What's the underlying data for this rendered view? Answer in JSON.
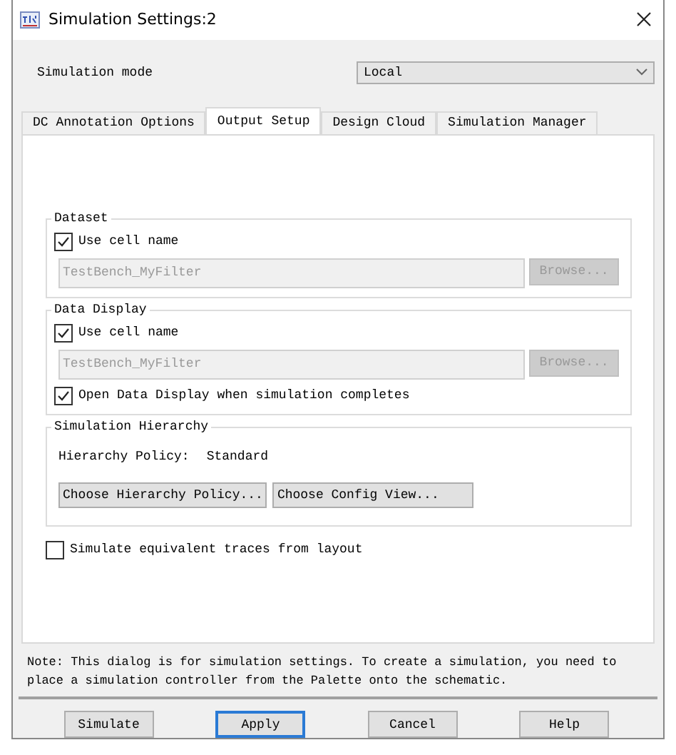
{
  "window": {
    "title": "Simulation Settings:2"
  },
  "simulation_mode": {
    "label": "Simulation mode",
    "value": "Local"
  },
  "tabs": [
    {
      "label": "DC Annotation Options",
      "selected": false
    },
    {
      "label": "Output Setup",
      "selected": true
    },
    {
      "label": "Design Cloud",
      "selected": false
    },
    {
      "label": "Simulation Manager",
      "selected": false
    }
  ],
  "groups": [
    {
      "title": "Dataset",
      "rows": [
        {
          "kind": "checkbox",
          "label": "Use cell name",
          "checked": true
        },
        {
          "kind": "path",
          "value": "TestBench_MyFilter",
          "button": "Browse...",
          "disabled": true
        }
      ]
    },
    {
      "title": "Data Display",
      "rows": [
        {
          "kind": "checkbox",
          "label": "Use cell name",
          "checked": true
        },
        {
          "kind": "path",
          "value": "TestBench_MyFilter",
          "button": "Browse...",
          "disabled": true
        },
        {
          "kind": "checkbox",
          "label": "Open Data Display when simulation completes",
          "checked": true
        }
      ]
    },
    {
      "title": "Simulation Hierarchy",
      "rows": [
        {
          "kind": "info",
          "label": "Hierarchy Policy:",
          "value": "Standard"
        },
        {
          "kind": "buttons",
          "buttons": [
            "Choose Hierarchy Policy...",
            "Choose Config View..."
          ]
        }
      ]
    }
  ],
  "options": [
    {
      "label": "Simulate equivalent traces from layout",
      "checked": false
    }
  ],
  "note": "Note: This dialog is for simulation settings. To create a simulation, you need to place a simulation controller from the Palette onto the schematic.",
  "buttons": [
    {
      "label": "Simulate",
      "focused": false
    },
    {
      "label": "Apply",
      "focused": true
    },
    {
      "label": "Cancel",
      "focused": false
    },
    {
      "label": "Help",
      "focused": false
    }
  ]
}
